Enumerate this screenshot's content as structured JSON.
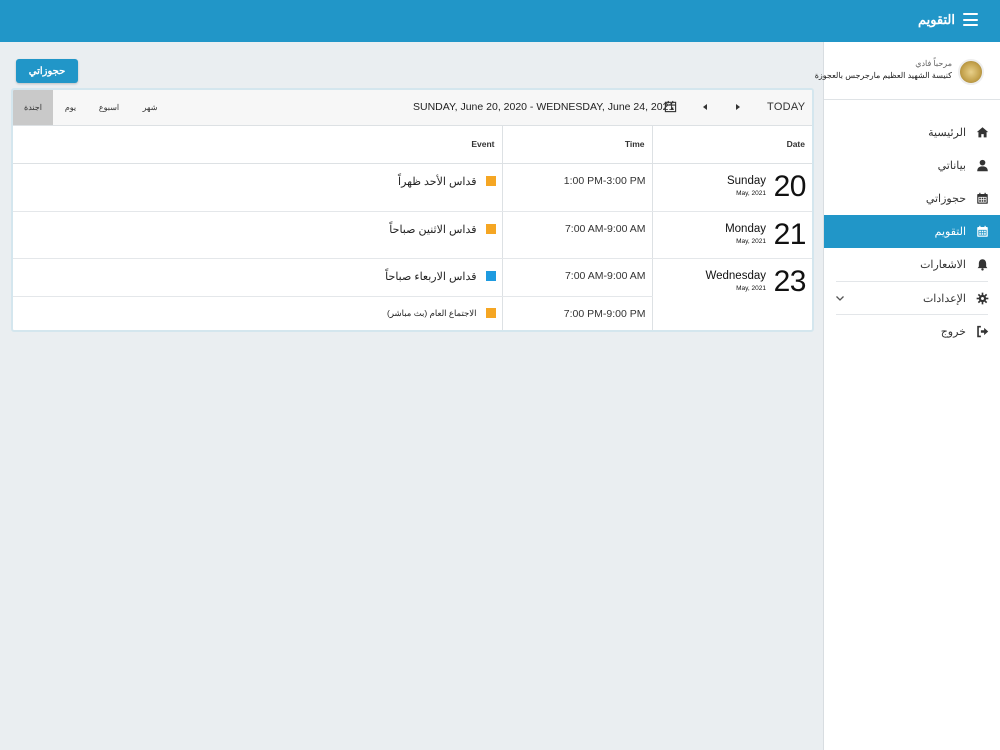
{
  "header": {
    "title": "التقويم",
    "menu_icon": "hamburger-icon",
    "color": "#2196c8"
  },
  "sidebar": {
    "greeting": "مرحباً فادي",
    "church": "كنيسة الشهيد العظيم مارجرجس بالعجوزة",
    "items": [
      {
        "label": "الرئيسية",
        "icon": "home-icon"
      },
      {
        "label": "بياناتي",
        "icon": "user-icon"
      },
      {
        "label": "حجوزاتي",
        "icon": "calendar-icon"
      },
      {
        "label": "التقويم",
        "icon": "calendar-icon",
        "active": true
      },
      {
        "label": "الاشعارات",
        "icon": "bell-icon"
      },
      {
        "label": "الإعدادات",
        "icon": "gear-icon"
      },
      {
        "label": "خروج",
        "icon": "sign-out-icon"
      }
    ]
  },
  "main": {
    "reserve_button": "حجوزاتي"
  },
  "calendar": {
    "views": {
      "agenda": "اجندة",
      "day": "يوم",
      "week": "اسبوع",
      "month": "شهر"
    },
    "range": "SUNDAY, June 20, 2020 - WEDNESDAY, June 24, 2021",
    "today": "TODAY",
    "columns": {
      "date": "Date",
      "time": "Time",
      "event": "Event"
    },
    "days": [
      {
        "num": "20",
        "name": "Sunday",
        "month": "May, 2021"
      },
      {
        "num": "21",
        "name": "Monday",
        "month": "May, 2021"
      },
      {
        "num": "23",
        "name": "Wednesday",
        "month": "May, 2021"
      }
    ],
    "events": [
      {
        "time": "1:00 PM-3:00 PM",
        "title": "قداس الأحد ظهراً",
        "color": "#f5a623"
      },
      {
        "time": "7:00 AM-9:00 AM",
        "title": "قداس الاثنين صباحاً",
        "color": "#f5a623"
      },
      {
        "time": "7:00 AM-9:00 AM",
        "title": "قداس الاربعاء صباحاً",
        "color": "#1e9be0"
      },
      {
        "time": "7:00 PM-9:00 PM",
        "title": "الاجتماع العام (بث مباشر)",
        "color": "#f5a623"
      }
    ]
  }
}
